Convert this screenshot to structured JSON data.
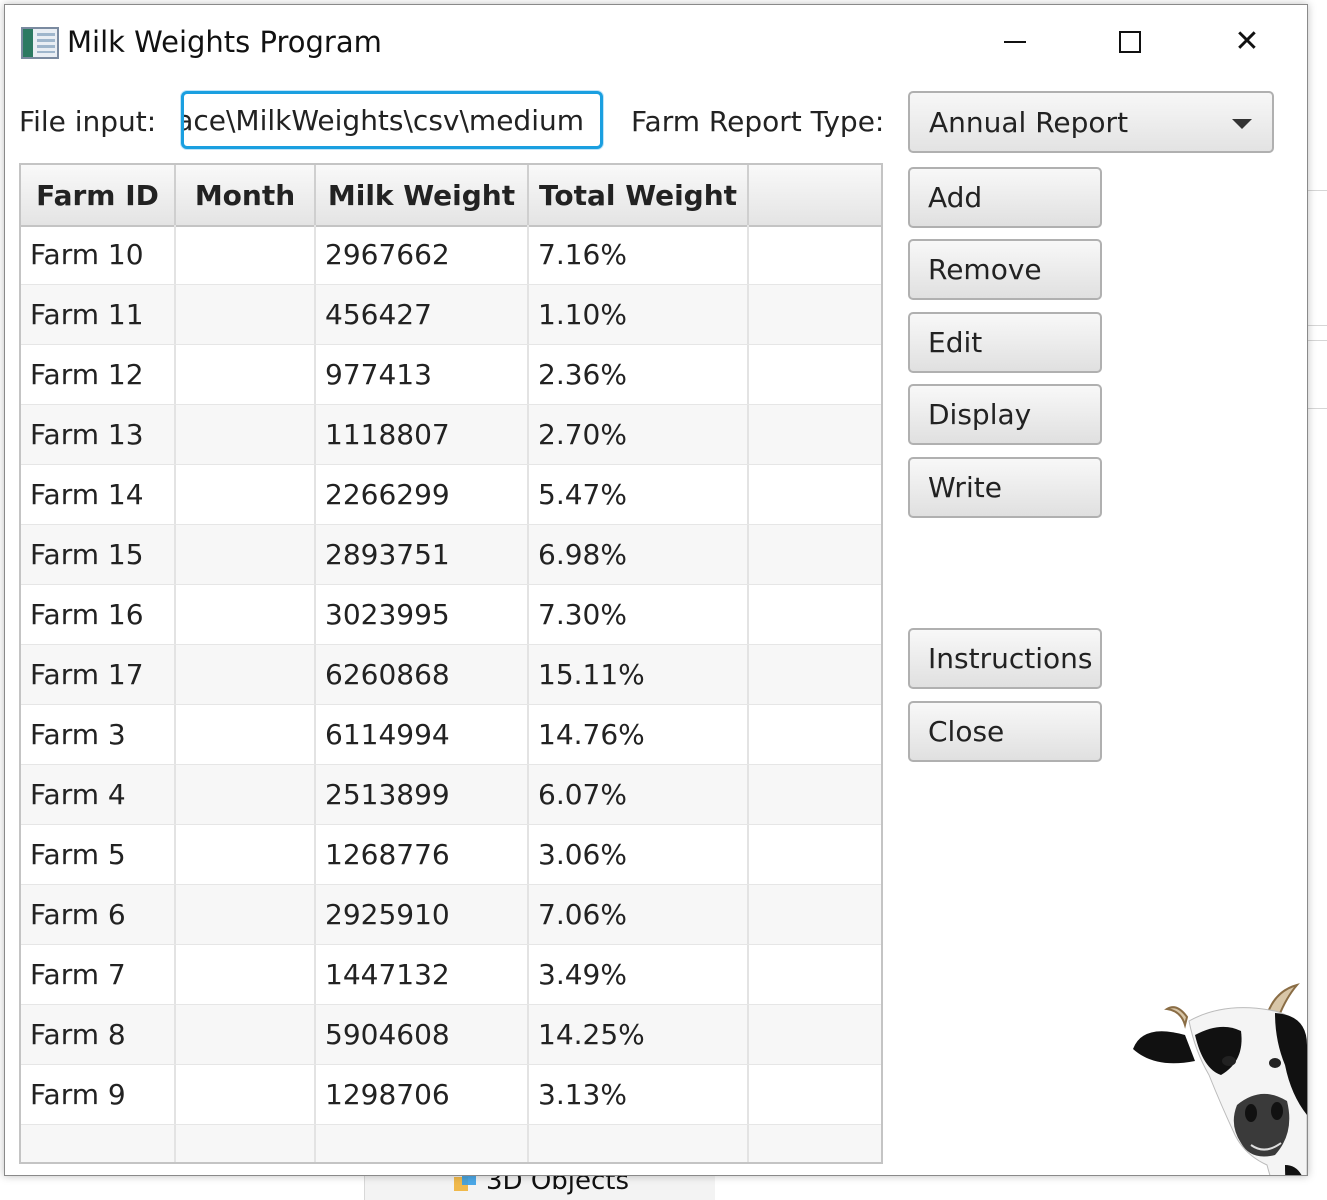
{
  "window": {
    "title": "Milk Weights Program"
  },
  "controls": {
    "file_label": "File input:",
    "file_value": "ace\\MilkWeights\\csv\\medium",
    "report_type_label": "Farm Report Type:",
    "report_type_selected": "Annual Report"
  },
  "buttons": {
    "add": "Add",
    "remove": "Remove",
    "edit": "Edit",
    "display": "Display",
    "write": "Write",
    "instructions": "Instructions",
    "close": "Close"
  },
  "table": {
    "columns": [
      "Farm ID",
      "Month",
      "Milk Weight",
      "Total Weight",
      ""
    ],
    "rows": [
      [
        "Farm 10",
        "",
        "2967662",
        "7.16%",
        ""
      ],
      [
        "Farm 11",
        "",
        "456427",
        "1.10%",
        ""
      ],
      [
        "Farm 12",
        "",
        "977413",
        "2.36%",
        ""
      ],
      [
        "Farm 13",
        "",
        "1118807",
        "2.70%",
        ""
      ],
      [
        "Farm 14",
        "",
        "2266299",
        "5.47%",
        ""
      ],
      [
        "Farm 15",
        "",
        "2893751",
        "6.98%",
        ""
      ],
      [
        "Farm 16",
        "",
        "3023995",
        "7.30%",
        ""
      ],
      [
        "Farm 17",
        "",
        "6260868",
        "15.11%",
        ""
      ],
      [
        "Farm 3",
        "",
        "6114994",
        "14.76%",
        ""
      ],
      [
        "Farm 4",
        "",
        "2513899",
        "6.07%",
        ""
      ],
      [
        "Farm 5",
        "",
        "1268776",
        "3.06%",
        ""
      ],
      [
        "Farm 6",
        "",
        "2925910",
        "7.06%",
        ""
      ],
      [
        "Farm 7",
        "",
        "1447132",
        "3.49%",
        ""
      ],
      [
        "Farm 8",
        "",
        "5904608",
        "14.25%",
        ""
      ],
      [
        "Farm 9",
        "",
        "1298706",
        "3.13%",
        ""
      ],
      [
        "",
        "",
        "",
        "",
        ""
      ]
    ]
  },
  "background": {
    "explorer_item": "3D Objects"
  },
  "icons": {
    "app": "app-window-icon",
    "minimize": "minimize-icon",
    "maximize": "maximize-icon",
    "close": "close-icon",
    "dropdown": "chevron-down-icon",
    "cow": "cow-image",
    "folder3d": "3d-objects-icon"
  }
}
